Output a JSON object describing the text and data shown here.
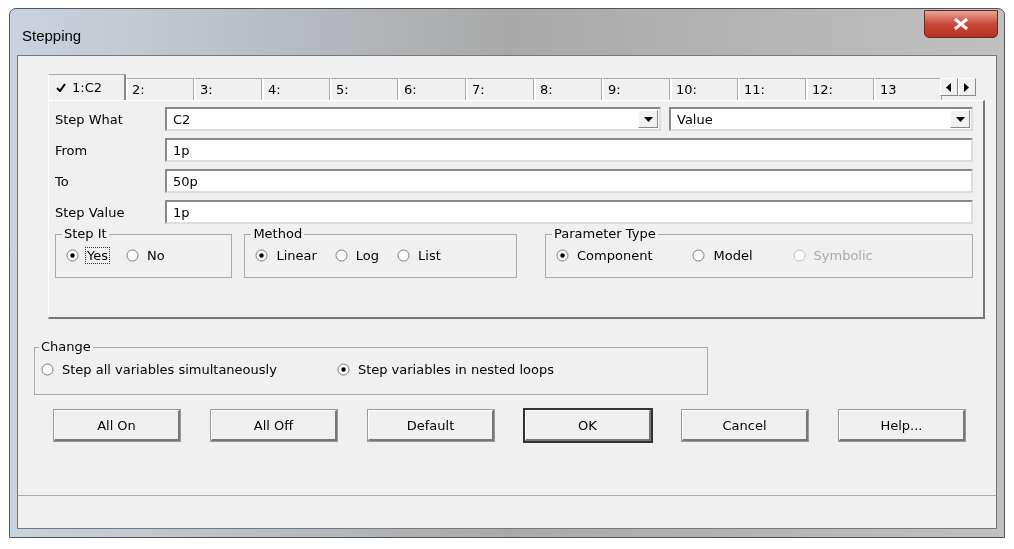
{
  "window": {
    "title": "Stepping"
  },
  "tabs": [
    {
      "label": "1:C2",
      "selected": true,
      "checked": true
    },
    {
      "label": "2:",
      "selected": false,
      "checked": false
    },
    {
      "label": "3:",
      "selected": false,
      "checked": false
    },
    {
      "label": "4:",
      "selected": false,
      "checked": false
    },
    {
      "label": "5:",
      "selected": false,
      "checked": false
    },
    {
      "label": "6:",
      "selected": false,
      "checked": false
    },
    {
      "label": "7:",
      "selected": false,
      "checked": false
    },
    {
      "label": "8:",
      "selected": false,
      "checked": false
    },
    {
      "label": "9:",
      "selected": false,
      "checked": false
    },
    {
      "label": "10:",
      "selected": false,
      "checked": false
    },
    {
      "label": "11:",
      "selected": false,
      "checked": false
    },
    {
      "label": "12:",
      "selected": false,
      "checked": false
    },
    {
      "label": "13",
      "selected": false,
      "checked": false
    }
  ],
  "step_what": {
    "label": "Step What",
    "value": "C2",
    "property": "Value"
  },
  "fields": [
    {
      "label": "From",
      "value": "1p"
    },
    {
      "label": "To",
      "value": "50p"
    },
    {
      "label": "Step Value",
      "value": "1p"
    }
  ],
  "groups": [
    {
      "title": "Step It",
      "options": [
        {
          "label": "Yes",
          "selected": true,
          "disabled": false,
          "focused": true
        },
        {
          "label": "No",
          "selected": false,
          "disabled": false,
          "focused": false
        }
      ]
    },
    {
      "title": "Method",
      "options": [
        {
          "label": "Linear",
          "selected": true,
          "disabled": false,
          "focused": false
        },
        {
          "label": "Log",
          "selected": false,
          "disabled": false,
          "focused": false
        },
        {
          "label": "List",
          "selected": false,
          "disabled": false,
          "focused": false
        }
      ]
    },
    {
      "title": "Parameter Type",
      "options": [
        {
          "label": "Component",
          "selected": true,
          "disabled": false,
          "focused": false
        },
        {
          "label": "Model",
          "selected": false,
          "disabled": false,
          "focused": false
        },
        {
          "label": "Symbolic",
          "selected": false,
          "disabled": true,
          "focused": false
        }
      ]
    }
  ],
  "change": {
    "title": "Change",
    "options": [
      {
        "label": "Step all variables simultaneously",
        "selected": false
      },
      {
        "label": "Step variables in nested loops",
        "selected": true
      }
    ]
  },
  "buttons": [
    {
      "label": "All On",
      "default": false
    },
    {
      "label": "All Off",
      "default": false
    },
    {
      "label": "Default",
      "default": false
    },
    {
      "label": "OK",
      "default": true
    },
    {
      "label": "Cancel",
      "default": false
    },
    {
      "label": "Help...",
      "default": false
    }
  ]
}
